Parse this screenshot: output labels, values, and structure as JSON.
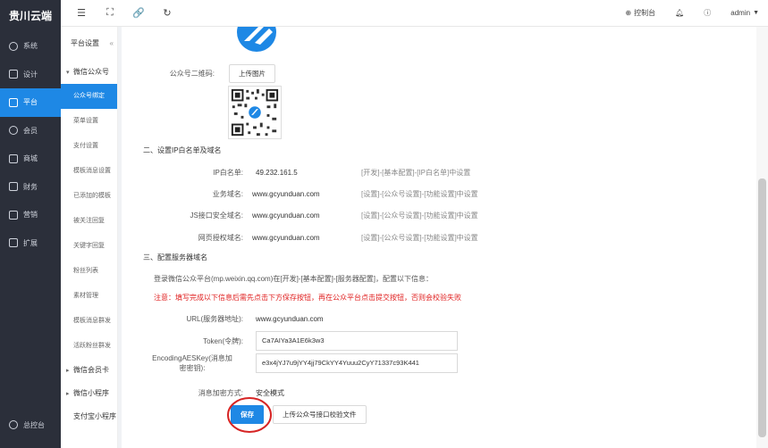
{
  "brand": "贵川云端",
  "main_nav": [
    {
      "label": "系统",
      "icon": "gear-icon"
    },
    {
      "label": "设计",
      "icon": "design-icon"
    },
    {
      "label": "平台",
      "icon": "platform-icon",
      "active": true
    },
    {
      "label": "会员",
      "icon": "user-icon"
    },
    {
      "label": "商城",
      "icon": "shop-icon"
    },
    {
      "label": "财务",
      "icon": "finance-icon"
    },
    {
      "label": "营销",
      "icon": "marketing-icon"
    },
    {
      "label": "扩展",
      "icon": "extend-icon"
    }
  ],
  "bottom_nav": {
    "label": "总控台",
    "icon": "console-icon"
  },
  "topbar": {
    "control_panel": "控制台",
    "user": "admin"
  },
  "subnav": {
    "title": "平台设置",
    "groups": {
      "wechat_official": "微信公众号",
      "wechat_card": "微信会员卡",
      "mini_program": "微信小程序",
      "alipay_mini": "支付宝小程序"
    },
    "items": [
      "公众号绑定",
      "菜单设置",
      "支付设置",
      "模板消息设置",
      "已添加的模板",
      "被关注回复",
      "关键字回复",
      "粉丝列表",
      "素材管理",
      "模板消息群发",
      "活跃粉丝群发"
    ]
  },
  "qr_section": {
    "label": "公众号二维码:",
    "upload_btn": "上传图片"
  },
  "section2": {
    "title": "二、设置IP白名单及域名",
    "rows": [
      {
        "label": "IP白名单:",
        "value": "49.232.161.5",
        "hint": "[开发]-[基本配置]-[IP白名单]中设置"
      },
      {
        "label": "业务域名:",
        "value": "www.gcyunduan.com",
        "hint": "[设置]-[公众号设置]-[功能设置]中设置"
      },
      {
        "label": "JS接口安全域名:",
        "value": "www.gcyunduan.com",
        "hint": "[设置]-[公众号设置]-[功能设置]中设置"
      },
      {
        "label": "网页授权域名:",
        "value": "www.gcyunduan.com",
        "hint": "[设置]-[公众号设置]-[功能设置]中设置"
      }
    ]
  },
  "section3": {
    "title": "三、配置服务器域名",
    "desc": "登录微信公众平台(mp.weixin.qq.com)在[开发]-[基本配置]-[服务器配置]，配置以下信息：",
    "warning": "注意：填写完成以下信息后需先点击下方保存按钮，再在公众平台点击提交按钮，否则会校验失败",
    "url_label": "URL(服务器地址):",
    "url_value": "www.gcyunduan.com",
    "token_label": "Token(令牌):",
    "token_value": "Ca7AIYa3A1E6k3w3",
    "aes_label1": "EncodingAESKey(消息加",
    "aes_label2": "密密钥):",
    "aes_value": "e3x4jYJ7u9jYY4jj79CkYY4Yuuu2CyY71337c93K441",
    "mode_label": "消息加密方式:",
    "mode_value": "安全模式",
    "save_btn": "保存",
    "upload_verify_btn": "上传公众号接口校验文件"
  },
  "colors": {
    "accent": "#1e88e5",
    "sidebar": "#2b2f3a",
    "warning": "#e02020",
    "circle": "#d62424"
  }
}
